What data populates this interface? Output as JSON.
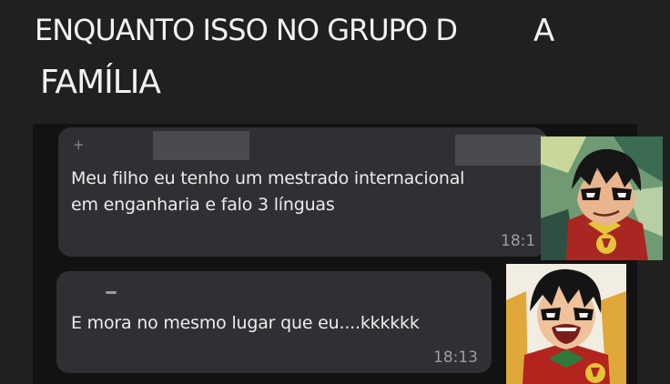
{
  "caption": {
    "line1": "ENQUANTO ISSO NO GRUPO D",
    "line1_tail": "A",
    "line2": "FAMÍLIA"
  },
  "messages": [
    {
      "sender": "+",
      "lines": [
        "Meu filho eu tenho um mestrado internacional",
        "em enganharia e falo 3 línguas"
      ],
      "time": "18:1"
    },
    {
      "text": "E mora no mesmo lugar que eu....kkkkkk",
      "time": "18:13"
    }
  ],
  "colors": {
    "page_background": "#202020",
    "chat_background": "#121212",
    "bubble": "#2f3033",
    "message_text": "#ececec",
    "timestamp": "#9e9e9e"
  },
  "icons": {
    "reaction_top": "smirking-robin-comic-panel",
    "reaction_bottom": "shouting-robin-comic-panel"
  }
}
